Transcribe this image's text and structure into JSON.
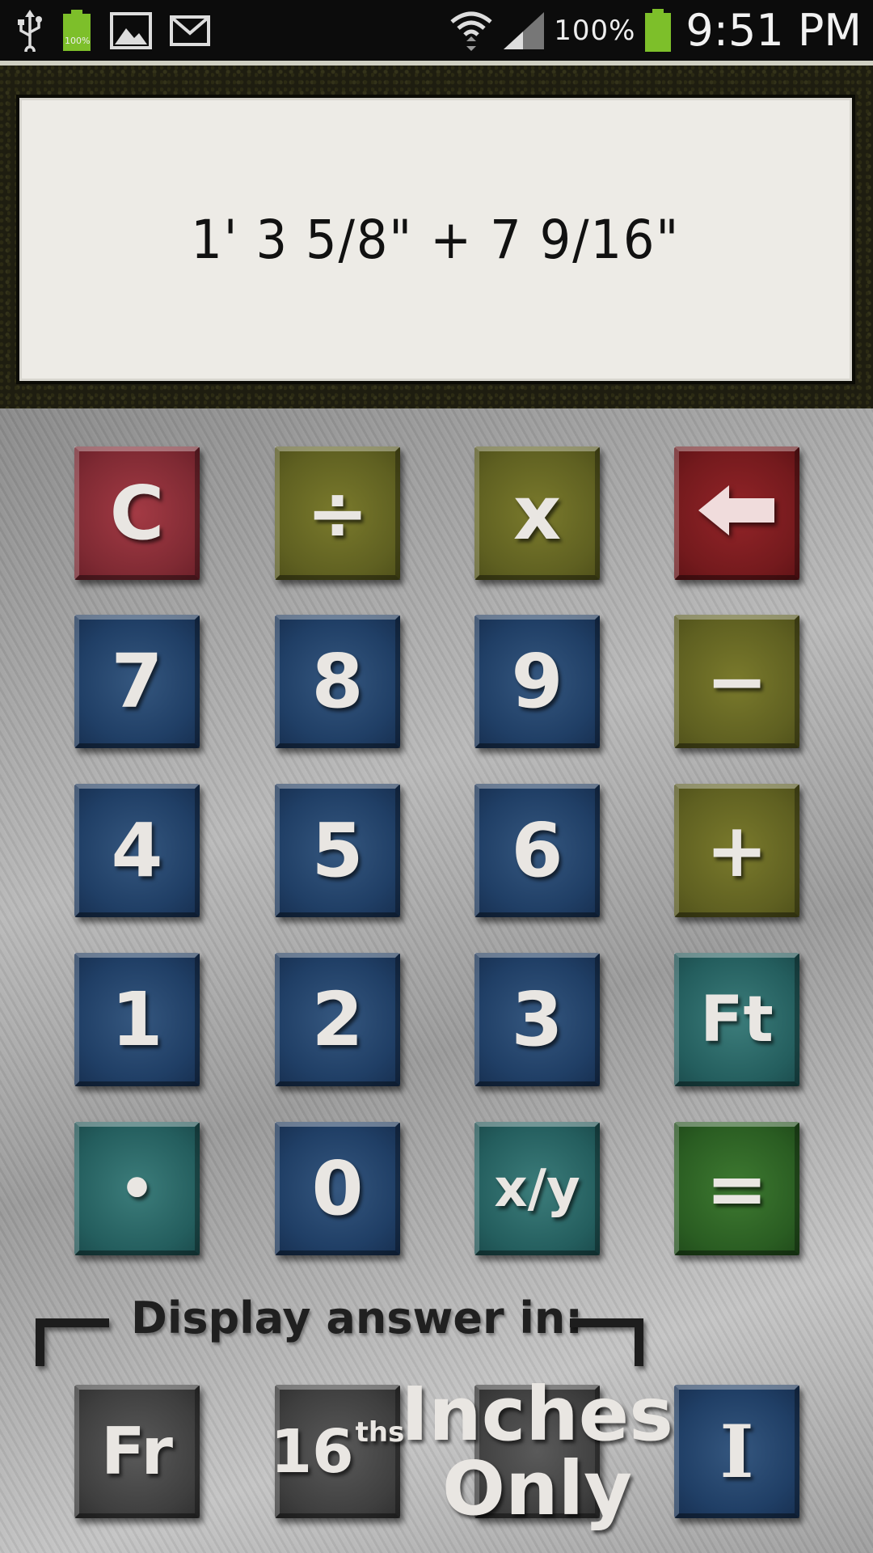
{
  "status_bar": {
    "battery_small_label": "100%",
    "battery_percent": "100%",
    "time": "9:51 PM",
    "icons": [
      "usb-icon",
      "battery-icon",
      "gallery-icon",
      "gmail-icon",
      "wifi-icon",
      "signal-icon",
      "battery-icon"
    ]
  },
  "display": {
    "expression": "1' 3  5/8\" + 7  9/16\""
  },
  "keys": {
    "clear": "C",
    "divide": "÷",
    "multiply": "x",
    "seven": "7",
    "eight": "8",
    "nine": "9",
    "minus": "−",
    "four": "4",
    "five": "5",
    "six": "6",
    "plus": "+",
    "one": "1",
    "two": "2",
    "three": "3",
    "feet": "Ft",
    "dot": "•",
    "zero": "0",
    "fraction": "x/y",
    "equals": "="
  },
  "display_answer": {
    "label": "Display answer in:",
    "fraction_button": "Fr",
    "sixteenths_number": "16",
    "sixteenths_sup": "ths",
    "inches_only_line1": "Inches",
    "inches_only_line2": "Only",
    "i_button": "I"
  },
  "colors": {
    "red": "#7f2a33",
    "dark_red": "#741a1d",
    "olive": "#5f6021",
    "blue": "#203f66",
    "teal": "#245e5e",
    "green": "#2a5d22",
    "gray": "#3f3f3f",
    "display_bg": "#edebe6"
  }
}
